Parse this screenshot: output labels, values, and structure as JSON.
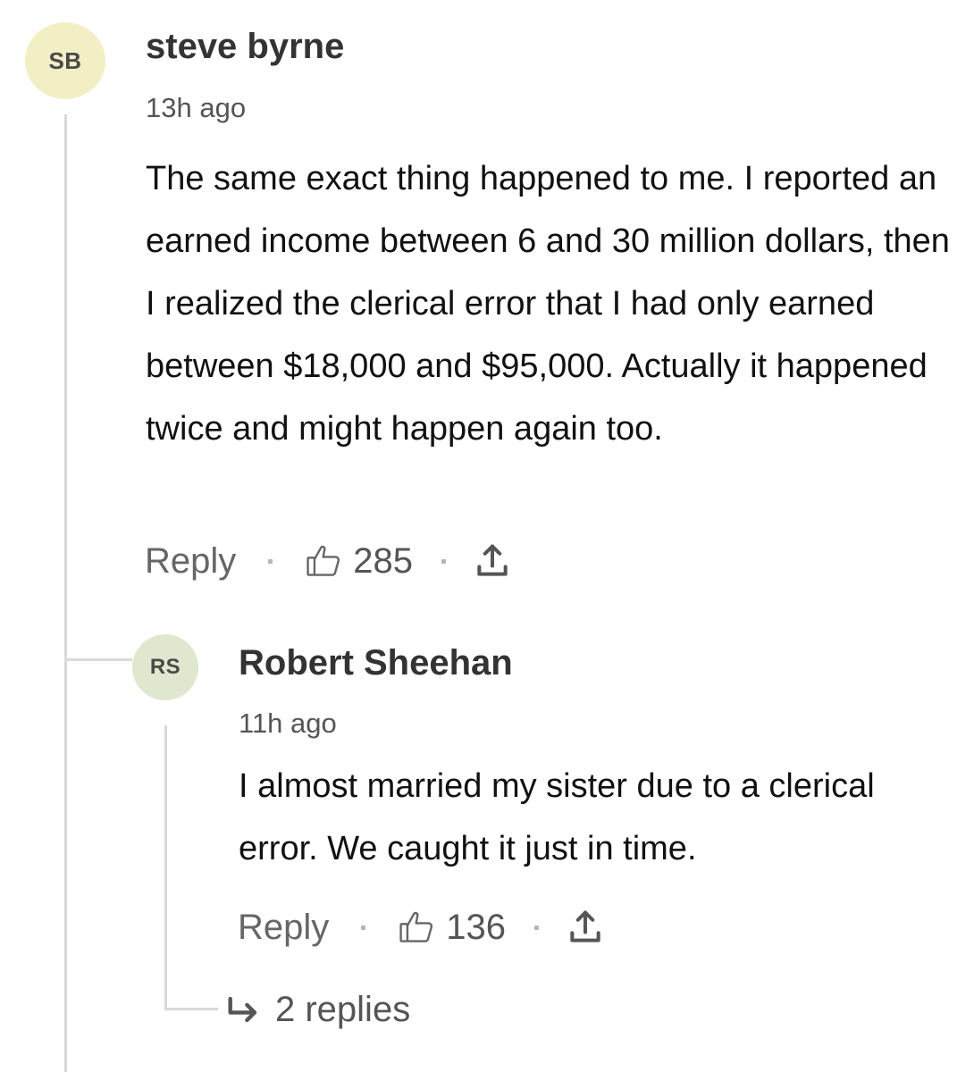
{
  "comments": [
    {
      "initials": "SB",
      "author": "steve byrne",
      "time": "13h ago",
      "body": "The same exact thing happened to me. I reported an earned income between 6 and 30 million dollars, then I realized the clerical error that I had only earned between $18,000 and $95,000. Actually it happened twice and might happen again too.",
      "reply_label": "Reply",
      "likes": "285",
      "avatar_color": "#f2efc4"
    },
    {
      "initials": "RS",
      "author": "Robert Sheehan",
      "time": "11h ago",
      "body": "I almost married my sister due to a clerical error. We caught it just in time.",
      "reply_label": "Reply",
      "likes": "136",
      "replies_label": "2 replies",
      "avatar_color": "#dfe8cf"
    }
  ],
  "icons": {
    "like": "thumbs-up-icon",
    "share": "share-icon",
    "replies": "reply-arrow-icon"
  }
}
